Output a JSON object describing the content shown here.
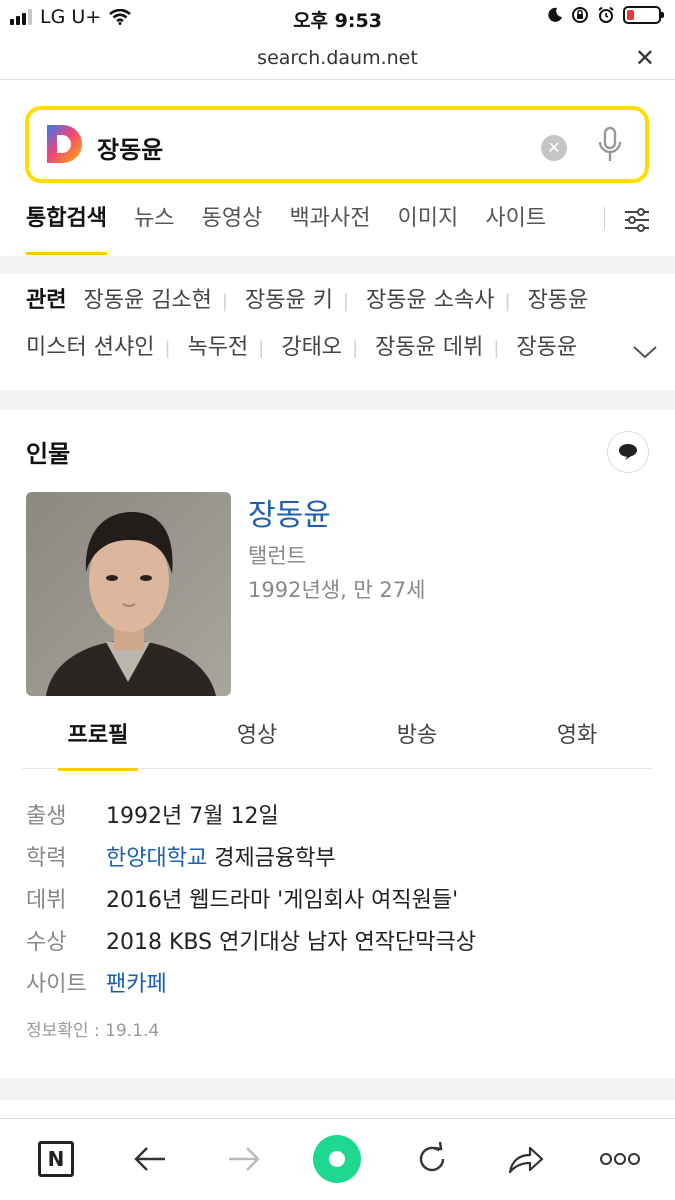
{
  "status_bar": {
    "carrier": "LG U+",
    "time": "오후 9:53"
  },
  "browser": {
    "url": "search.daum.net"
  },
  "search": {
    "query": "장동윤"
  },
  "tabs": [
    "통합검색",
    "뉴스",
    "동영상",
    "백과사전",
    "이미지",
    "사이트"
  ],
  "related": {
    "label": "관련",
    "row1": [
      "장동윤 김소현",
      "장동윤 키",
      "장동윤 소속사",
      "장동윤"
    ],
    "row2": [
      "미스터 션샤인",
      "녹두전",
      "강태오",
      "장동윤 데뷔",
      "장동윤"
    ]
  },
  "person": {
    "section_title": "인물",
    "name": "장동윤",
    "job": "탤런트",
    "age": "1992년생, 만 27세",
    "subtabs": [
      "프로필",
      "영상",
      "방송",
      "영화"
    ],
    "profile": {
      "birth": {
        "label": "출생",
        "value": "1992년 7월 12일"
      },
      "education": {
        "label": "학력",
        "link": "한양대학교",
        "value": "경제금융학부"
      },
      "debut": {
        "label": "데뷔",
        "value": "2016년 웹드라마 '게임회사 여직원들'"
      },
      "award": {
        "label": "수상",
        "value": "2018 KBS 연기대상 남자 연작단막극상"
      },
      "site": {
        "label": "사이트",
        "link": "팬카페"
      }
    },
    "checked": "정보확인 : 19.1.4"
  },
  "toolbar": {
    "n_label": "N"
  },
  "colors": {
    "accent_yellow": "#ffdd00",
    "link_blue": "#1a5fb4",
    "green_button": "#1ed891"
  }
}
